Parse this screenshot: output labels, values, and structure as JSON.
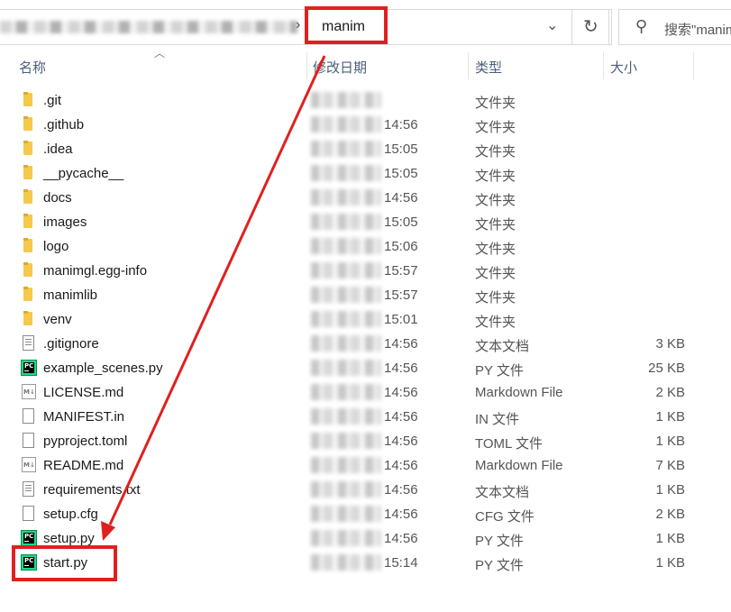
{
  "address": {
    "current_folder": "manim",
    "separator": "›"
  },
  "search": {
    "placeholder": "搜索\"manim\""
  },
  "columns": {
    "name": "名称",
    "date": "修改日期",
    "type": "类型",
    "size": "大小"
  },
  "files": [
    {
      "name": ".git",
      "time": "",
      "type": "文件夹",
      "size": "",
      "icon": "folder-icon"
    },
    {
      "name": ".github",
      "time": "14:56",
      "type": "文件夹",
      "size": "",
      "icon": "folder-icon"
    },
    {
      "name": ".idea",
      "time": "15:05",
      "type": "文件夹",
      "size": "",
      "icon": "folder-icon"
    },
    {
      "name": "__pycache__",
      "time": "15:05",
      "type": "文件夹",
      "size": "",
      "icon": "folder-icon"
    },
    {
      "name": "docs",
      "time": "14:56",
      "type": "文件夹",
      "size": "",
      "icon": "folder-icon"
    },
    {
      "name": "images",
      "time": "15:05",
      "type": "文件夹",
      "size": "",
      "icon": "folder-icon"
    },
    {
      "name": "logo",
      "time": "15:06",
      "type": "文件夹",
      "size": "",
      "icon": "folder-icon"
    },
    {
      "name": "manimgl.egg-info",
      "time": "15:57",
      "type": "文件夹",
      "size": "",
      "icon": "folder-icon"
    },
    {
      "name": "manimlib",
      "time": "15:57",
      "type": "文件夹",
      "size": "",
      "icon": "folder-icon"
    },
    {
      "name": "venv",
      "time": "15:01",
      "type": "文件夹",
      "size": "",
      "icon": "folder-icon"
    },
    {
      "name": ".gitignore",
      "time": "14:56",
      "type": "文本文档",
      "size": "3 KB",
      "icon": "text-file-icon"
    },
    {
      "name": "example_scenes.py",
      "time": "14:56",
      "type": "PY 文件",
      "size": "25 KB",
      "icon": "pycharm-file-icon"
    },
    {
      "name": "LICENSE.md",
      "time": "14:56",
      "type": "Markdown File",
      "size": "2 KB",
      "icon": "markdown-file-icon"
    },
    {
      "name": "MANIFEST.in",
      "time": "14:56",
      "type": "IN 文件",
      "size": "1 KB",
      "icon": "blank-file-icon"
    },
    {
      "name": "pyproject.toml",
      "time": "14:56",
      "type": "TOML 文件",
      "size": "1 KB",
      "icon": "blank-file-icon"
    },
    {
      "name": "README.md",
      "time": "14:56",
      "type": "Markdown File",
      "size": "7 KB",
      "icon": "markdown-file-icon"
    },
    {
      "name": "requirements.txt",
      "time": "14:56",
      "type": "文本文档",
      "size": "1 KB",
      "icon": "text-file-icon"
    },
    {
      "name": "setup.cfg",
      "time": "14:56",
      "type": "CFG 文件",
      "size": "2 KB",
      "icon": "blank-file-icon"
    },
    {
      "name": "setup.py",
      "time": "14:56",
      "type": "PY 文件",
      "size": "1 KB",
      "icon": "pycharm-file-icon"
    },
    {
      "name": "start.py",
      "time": "15:14",
      "type": "PY 文件",
      "size": "1 KB",
      "icon": "pycharm-file-icon"
    }
  ],
  "icon_labels": {
    "pycharm": "PC",
    "markdown": "M↓"
  },
  "colors": {
    "annotation": "#e02020",
    "folder": "#f5c94e",
    "pycharm": "#21d789"
  }
}
